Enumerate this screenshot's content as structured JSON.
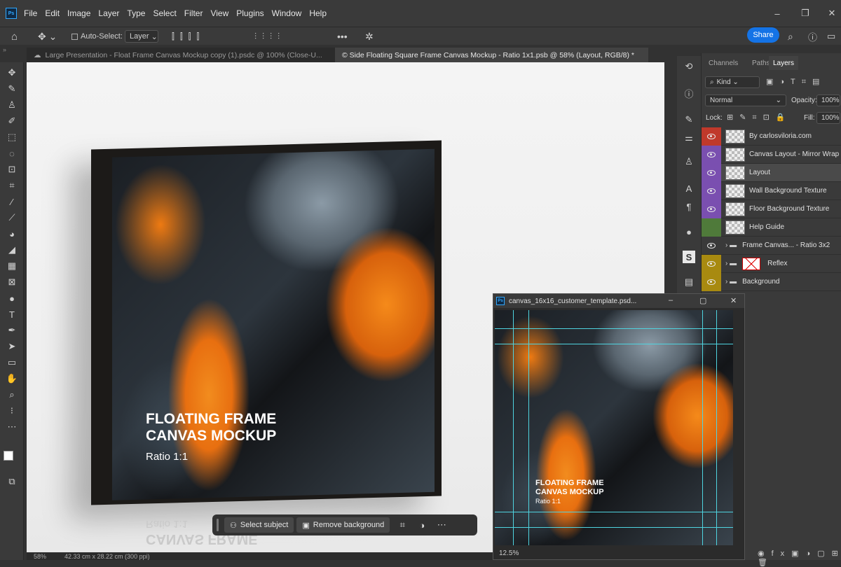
{
  "app": {
    "icon_label": "Ps"
  },
  "menu": [
    "File",
    "Edit",
    "Image",
    "Layer",
    "Type",
    "Select",
    "Filter",
    "View",
    "Plugins",
    "Window",
    "Help"
  ],
  "options": {
    "auto_select_label": "Auto-Select:",
    "auto_select_value": "Layer",
    "share_label": "Share"
  },
  "tabs": [
    {
      "label": "Large Presentation - Float Frame Canvas Mockup copy (1).psdc @ 100% (Close-U...",
      "active": false
    },
    {
      "label": "© Side Floating Square Frame Canvas Mockup - Ratio 1x1.psb @ 58% (Layout, RGB/8) *",
      "active": true
    }
  ],
  "canvas": {
    "headline_1": "FLOATING FRAME",
    "headline_2": "CANVAS MOCKUP",
    "ratio": "Ratio 1:1",
    "reflection_1": "Ratio 1:1",
    "reflection_2": "CANVAS FRAME"
  },
  "contextual_bar": {
    "select_subject": "Select subject",
    "remove_background": "Remove background"
  },
  "status": {
    "zoom": "58%",
    "dimensions": "42.33 cm x 28.22 cm (300 ppi)"
  },
  "panel": {
    "tabs": [
      "Channels",
      "Paths",
      "Layers"
    ],
    "active_tab": "Layers",
    "filter_kind": "Kind",
    "blend_mode": "Normal",
    "opacity_label": "Opacity:",
    "opacity_value": "100%",
    "lock_label": "Lock:",
    "fill_label": "Fill:",
    "fill_value": "100%",
    "layers": [
      {
        "name": "By carlosviloria.com",
        "color": "#c0392b",
        "visible": true,
        "selected": false,
        "kind": "layer"
      },
      {
        "name": "Canvas Layout - Mirror Wrap",
        "color": "#7a4fb0",
        "visible": true,
        "selected": false,
        "kind": "smart"
      },
      {
        "name": "Layout",
        "color": "#7a4fb0",
        "visible": true,
        "selected": true,
        "kind": "smart"
      },
      {
        "name": "Wall Background Texture",
        "color": "#7a4fb0",
        "visible": true,
        "selected": false,
        "kind": "smart"
      },
      {
        "name": "Floor Background Texture",
        "color": "#7a4fb0",
        "visible": true,
        "selected": false,
        "kind": "smart"
      },
      {
        "name": "Help Guide",
        "color": "#4f7a3a",
        "visible": false,
        "selected": false,
        "kind": "layer"
      },
      {
        "name": "Frame Canvas... - Ratio 3x2",
        "color": "",
        "visible": true,
        "selected": false,
        "kind": "group"
      },
      {
        "name": "Reflex",
        "color": "#a88a10",
        "visible": true,
        "selected": false,
        "kind": "group-masked"
      },
      {
        "name": "Background",
        "color": "#a88a10",
        "visible": true,
        "selected": false,
        "kind": "group"
      }
    ]
  },
  "float_doc": {
    "title": "canvas_16x16_customer_template.psd...",
    "zoom": "12.5%",
    "headline_1": "FLOATING FRAME",
    "headline_2": "CANVAS MOCKUP",
    "ratio": "Ratio 1:1"
  },
  "colors": {
    "accent": "#1473e6",
    "panel_bg": "#3a3a3a",
    "app_bg": "#323232"
  }
}
